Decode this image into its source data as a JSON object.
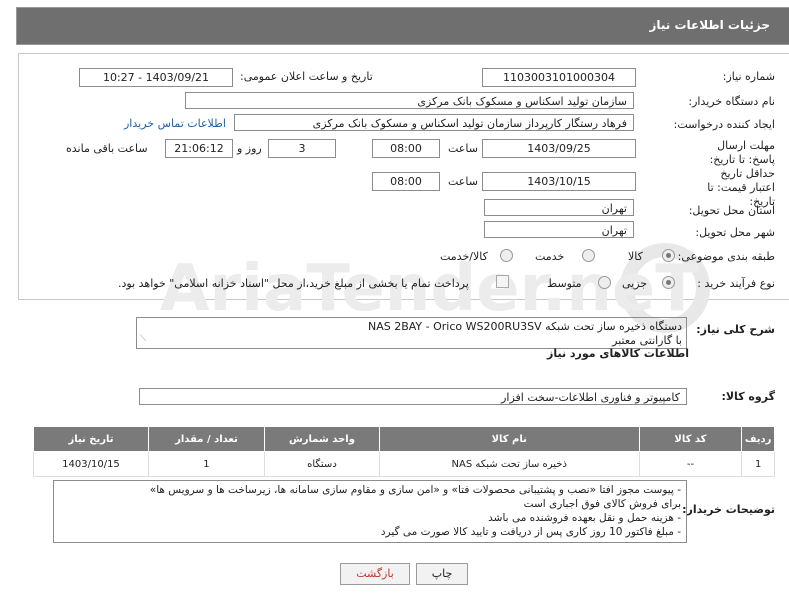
{
  "header": {
    "title": "جزئیات اطلاعات نیاز"
  },
  "form": {
    "need_number_label": "شماره نیاز:",
    "need_number": "1103003101000304",
    "announce_label": "تاریخ و ساعت اعلان عمومی:",
    "announce_value": "1403/09/21 - 10:27",
    "buyer_label": "نام دستگاه خریدار:",
    "buyer_value": "سازمان تولید اسکناس و مسکوک بانک مرکزی",
    "creator_label": "ایجاد کننده درخواست:",
    "creator_value": "فرهاد رستگار کارپرداز سازمان تولید اسکناس و مسکوک بانک مرکزی",
    "contact_link": "اطلاعات تماس خریدار",
    "deadline_label": "مهلت ارسال پاسخ: تا تاریخ:",
    "deadline_date": "1403/09/25",
    "time_label": "ساعت",
    "deadline_time": "08:00",
    "days_value": "3",
    "days_label": "روز و",
    "remaining_time": "21:06:12",
    "remaining_label": "ساعت باقی مانده",
    "validity_label": "حداقل تاریخ اعتبار قیمت: تا تاریخ:",
    "validity_date": "1403/10/15",
    "validity_time": "08:00",
    "province_label": "استان محل تحویل:",
    "province_value": "تهران",
    "city_label": "شهر محل تحویل:",
    "city_value": "تهران",
    "category_label": "طبقه بندی موضوعی:",
    "category_options": [
      "کالا",
      "خدمت",
      "کالا/خدمت"
    ],
    "process_label": "نوع فرآیند خرید :",
    "process_options": [
      "جزیی",
      "متوسط"
    ],
    "payment_note": "پرداخت تمام یا بخشی از مبلغ خرید،از محل \"اسناد خزانه اسلامی\" خواهد بود."
  },
  "description": {
    "label": "شرح کلی نیاز:",
    "line1": "دستگاه ذخیره ساز تحت شبکه NAS 2BAY - Orico WS200RU3SV",
    "line2": "با گارانتی معتبر"
  },
  "goods_info": {
    "title": "اطلاعات کالاهای مورد نیاز",
    "group_label": "گروه کالا:",
    "group_value": "کامپیوتر و فناوری اطلاعات-سخت افزار"
  },
  "table": {
    "headers": [
      "ردیف",
      "کد کالا",
      "نام کالا",
      "واحد شمارش",
      "تعداد / مقدار",
      "تاریخ نیاز"
    ],
    "rows": [
      [
        "1",
        "--",
        "ذخیره ساز تحت شبکه NAS",
        "دستگاه",
        "1",
        "1403/10/15"
      ]
    ]
  },
  "buyer_notes": {
    "label": "توضیحات خریدار:",
    "lines": [
      "- پیوست مجوز افتا «نصب و پشتیبانی محصولات فتا» و «امن سازی و مقاوم سازی سامانه ها، زیرساخت ها و سرویس ها»",
      "برای فروش کالای فوق اجباری است",
      "- هزینه حمل و نقل بعهده فروشنده می باشد",
      "- مبلغ فاکتور 10 روز کاری پس از دریافت و تایید کالا صورت می گیرد"
    ]
  },
  "buttons": {
    "print": "چاپ",
    "back": "بازگشت"
  },
  "watermark": "AriaTender.neT"
}
